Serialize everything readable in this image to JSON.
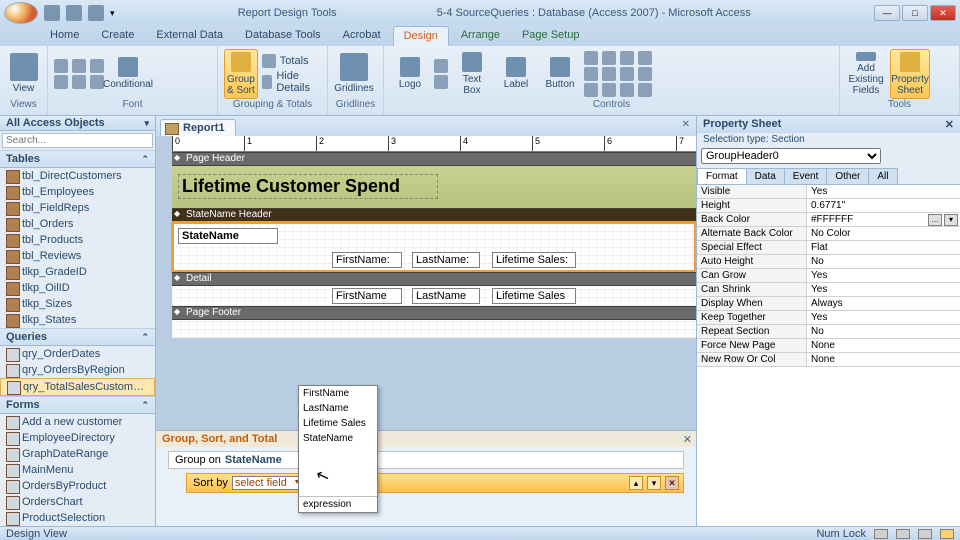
{
  "title_context": "Report Design Tools",
  "title_main": "5-4 SourceQueries : Database (Access 2007) - Microsoft Access",
  "ribbon_tabs": [
    "Home",
    "Create",
    "External Data",
    "Database Tools",
    "Acrobat"
  ],
  "ribbon_context_tabs": [
    "Design",
    "Arrange",
    "Page Setup"
  ],
  "ribbon_active_tab": "Design",
  "ribbon_groups": {
    "views": "Views",
    "font": "Font",
    "grouping": "Grouping & Totals",
    "gridlines": "Gridlines",
    "controls": "Controls",
    "tools": "Tools"
  },
  "ribbon_items": {
    "view": "View",
    "conditional": "Conditional",
    "group_sort": "Group\n& Sort",
    "totals": "Totals",
    "hide_details": "Hide Details",
    "gridlines": "Gridlines",
    "logo": "Logo",
    "textbox": "Text\nBox",
    "label": "Label",
    "button": "Button",
    "add_fields": "Add Existing\nFields",
    "prop_sheet": "Property\nSheet"
  },
  "nav": {
    "title": "All Access Objects",
    "search_placeholder": "Search...",
    "sections": {
      "tables": "Tables",
      "queries": "Queries",
      "forms": "Forms"
    },
    "tables": [
      "tbl_DirectCustomers",
      "tbl_Employees",
      "tbl_FieldReps",
      "tbl_Orders",
      "tbl_Products",
      "tbl_Reviews",
      "tlkp_GradeID",
      "tlkp_OilID",
      "tlkp_Sizes",
      "tlkp_States"
    ],
    "queries": [
      "qry_OrderDates",
      "qry_OrdersByRegion",
      "qry_TotalSalesCustomers"
    ],
    "queries_selected": "qry_TotalSalesCustomers",
    "forms": [
      "Add a new customer",
      "EmployeeDirectory",
      "GraphDateRange",
      "MainMenu",
      "OrdersByProduct",
      "OrdersChart",
      "ProductSelection"
    ]
  },
  "doc_tab": "Report1",
  "report": {
    "sections": {
      "page_header": "Page Header",
      "state_header": "StateName Header",
      "detail": "Detail",
      "page_footer": "Page Footer"
    },
    "title": "Lifetime Customer Spend",
    "group_field_label": "StateName",
    "col_labels": [
      "FirstName:",
      "LastName:",
      "Lifetime Sales:"
    ],
    "detail_fields": [
      "FirstName",
      "LastName",
      "Lifetime Sales"
    ]
  },
  "gst": {
    "title": "Group, Sort, and Total",
    "group_on": "Group on",
    "group_field": "StateName",
    "sort_by": "Sort by",
    "sort_sel": "select field"
  },
  "field_popup": [
    "FirstName",
    "LastName",
    "Lifetime Sales",
    "StateName"
  ],
  "field_popup_expr": "expression",
  "prop": {
    "title": "Property Sheet",
    "subtitle": "Selection type:  Section",
    "selector": "GroupHeader0",
    "tabs": [
      "Format",
      "Data",
      "Event",
      "Other",
      "All"
    ],
    "tab_active": "Format",
    "rows": [
      {
        "n": "Visible",
        "v": "Yes"
      },
      {
        "n": "Height",
        "v": "0.6771\""
      },
      {
        "n": "Back Color",
        "v": "#FFFFFF",
        "dd": true
      },
      {
        "n": "Alternate Back Color",
        "v": "No Color"
      },
      {
        "n": "Special Effect",
        "v": "Flat"
      },
      {
        "n": "Auto Height",
        "v": "No"
      },
      {
        "n": "Can Grow",
        "v": "Yes"
      },
      {
        "n": "Can Shrink",
        "v": "Yes"
      },
      {
        "n": "Display When",
        "v": "Always"
      },
      {
        "n": "Keep Together",
        "v": "Yes"
      },
      {
        "n": "Repeat Section",
        "v": "No"
      },
      {
        "n": "Force New Page",
        "v": "None"
      },
      {
        "n": "New Row Or Col",
        "v": "None"
      }
    ]
  },
  "status": {
    "left": "Design View",
    "numlock": "Num Lock"
  }
}
